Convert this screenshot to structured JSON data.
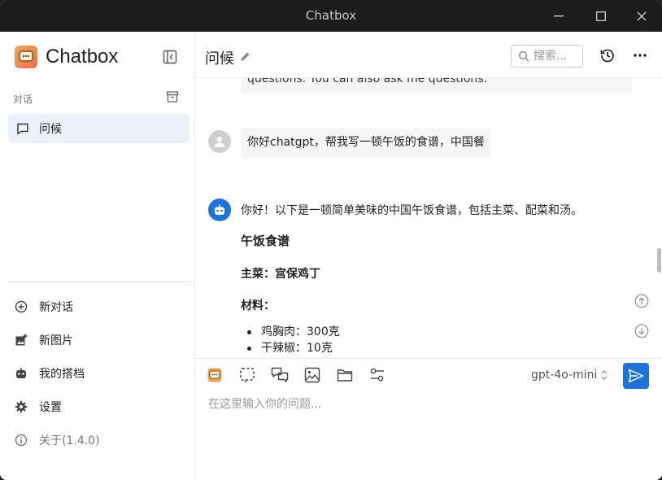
{
  "window": {
    "title": "Chatbox"
  },
  "sidebar": {
    "app_name": "Chatbox",
    "section_label": "对话",
    "conversations": [
      {
        "label": "问候"
      }
    ],
    "menu": {
      "new_chat": "新对话",
      "new_image": "新图片",
      "my_partner": "我的搭档",
      "settings": "设置",
      "about": "关于(1.4.0)"
    }
  },
  "header": {
    "title": "问候",
    "search_placeholder": "搜索..."
  },
  "messages": {
    "prev_snippet": "questions. You can also ask me questions.",
    "user_text": "你好chatgpt，帮我写一顿午饭的食谱，中国餐",
    "bot_intro": "你好！以下是一顿简单美味的中国午饭食谱，包括主菜、配菜和汤。",
    "bot_heading": "午饭食谱",
    "bot_main_dish": "主菜：宫保鸡丁",
    "bot_materials": "材料：",
    "bot_items": [
      "鸡胸肉：300克",
      "干辣椒：10克"
    ]
  },
  "composer": {
    "model": "gpt-4o-mini",
    "placeholder": "在这里输入你的问题..."
  },
  "colors": {
    "accent": "#1e73d8",
    "selected_bg": "#e9f1fb",
    "titlebar": "#1c1c1c"
  },
  "icons": {
    "sidebar": [
      "collapse-sidebar-icon",
      "archive-icon",
      "chat-bubble-icon",
      "plus-circle-icon",
      "image-plus-icon",
      "robot-icon",
      "gear-icon",
      "info-icon"
    ],
    "header": [
      "pencil-icon",
      "search-icon",
      "history-icon",
      "more-icon"
    ],
    "composer": [
      "chatbox-logo-icon",
      "selection-icon",
      "chat-switch-icon",
      "image-icon",
      "folder-icon",
      "settings-sliders-icon",
      "updown-icon",
      "send-icon"
    ]
  }
}
